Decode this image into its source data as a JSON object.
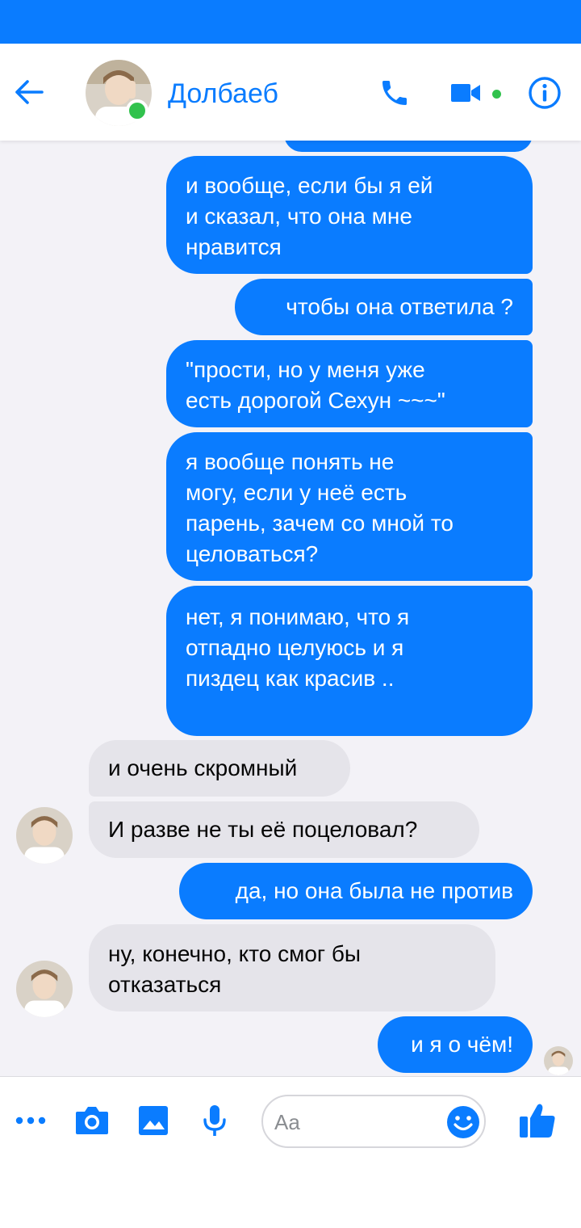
{
  "header": {
    "contact_name": "Долбаеб",
    "status": "online"
  },
  "icons": {
    "back": "back-arrow-icon",
    "call": "phone-icon",
    "video": "video-camera-icon",
    "info": "info-icon",
    "more": "more-dots-icon",
    "camera": "camera-icon",
    "gallery": "image-icon",
    "mic": "microphone-icon",
    "emoji": "emoji-icon",
    "like": "thumbs-up-icon"
  },
  "colors": {
    "accent": "#0a7cff",
    "outgoing_bubble": "#0a7cff",
    "incoming_bubble": "#e5e4ea",
    "online": "#31c24d"
  },
  "messages": [
    {
      "side": "out",
      "text": "и вообще, если бы я ей\nи сказал, что она мне\nнравится"
    },
    {
      "side": "out",
      "text": "чтобы она ответила ?"
    },
    {
      "side": "out",
      "text": "\"прости, но у меня уже\nесть дорогой Сехун ~~~\""
    },
    {
      "side": "out",
      "text": "я вообще понять не\nмогу, если у неё есть\nпарень, зачем со мной то\nцеловаться?"
    },
    {
      "side": "out",
      "text": "нет, я понимаю, что я\nотпадно целуюсь и я\nпиздец как красив .."
    },
    {
      "side": "in",
      "text": "и очень скромный"
    },
    {
      "side": "in",
      "text": "И разве не ты её поцеловал?"
    },
    {
      "side": "out",
      "text": "да, но она была не против"
    },
    {
      "side": "in",
      "text": "ну, конечно, кто смог бы\nотказаться"
    },
    {
      "side": "out",
      "text": "и я о чём!"
    }
  ],
  "composer": {
    "placeholder": "Aa"
  }
}
